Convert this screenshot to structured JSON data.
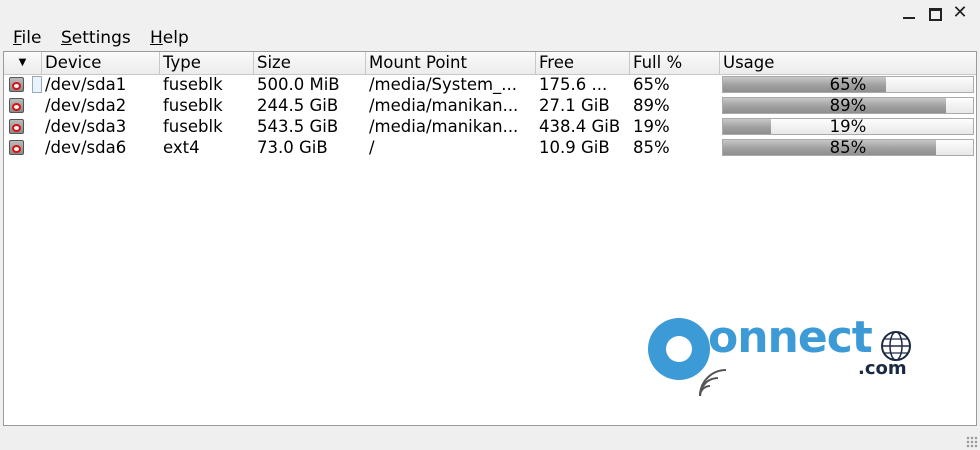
{
  "menu": {
    "file": {
      "key": "F",
      "rest": "ile"
    },
    "settings": {
      "key": "S",
      "rest": "ettings"
    },
    "help": {
      "key": "H",
      "rest": "elp"
    }
  },
  "window_controls": {
    "close": "✕"
  },
  "table": {
    "sort_indicator": "▼",
    "columns": [
      "Device",
      "Type",
      "Size",
      "Mount Point",
      "Free",
      "Full %",
      "Usage"
    ],
    "rows": [
      {
        "device": "/dev/sda1",
        "type": "fuseblk",
        "size": "500.0 MiB",
        "mount": "/media/System_...",
        "free": "175.6 ...",
        "full": "65%",
        "usage_pct": 65,
        "usage_label": "65%"
      },
      {
        "device": "/dev/sda2",
        "type": "fuseblk",
        "size": "244.5 GiB",
        "mount": "/media/manikan...",
        "free": "27.1 GiB",
        "full": "89%",
        "usage_pct": 89,
        "usage_label": "89%"
      },
      {
        "device": "/dev/sda3",
        "type": "fuseblk",
        "size": "543.5 GiB",
        "mount": "/media/manikan...",
        "free": "438.4 GiB",
        "full": "19%",
        "usage_pct": 19,
        "usage_label": "19%"
      },
      {
        "device": "/dev/sda6",
        "type": "ext4",
        "size": "73.0 GiB",
        "mount": "/",
        "free": "10.9 GiB",
        "full": "85%",
        "usage_pct": 85,
        "usage_label": "85%"
      }
    ]
  },
  "watermark": {
    "brand": "onnect",
    "suffix": ".com",
    "accent": "#3c9ad6"
  },
  "icons": {
    "device": "drive-icon",
    "globe": "globe-icon"
  }
}
